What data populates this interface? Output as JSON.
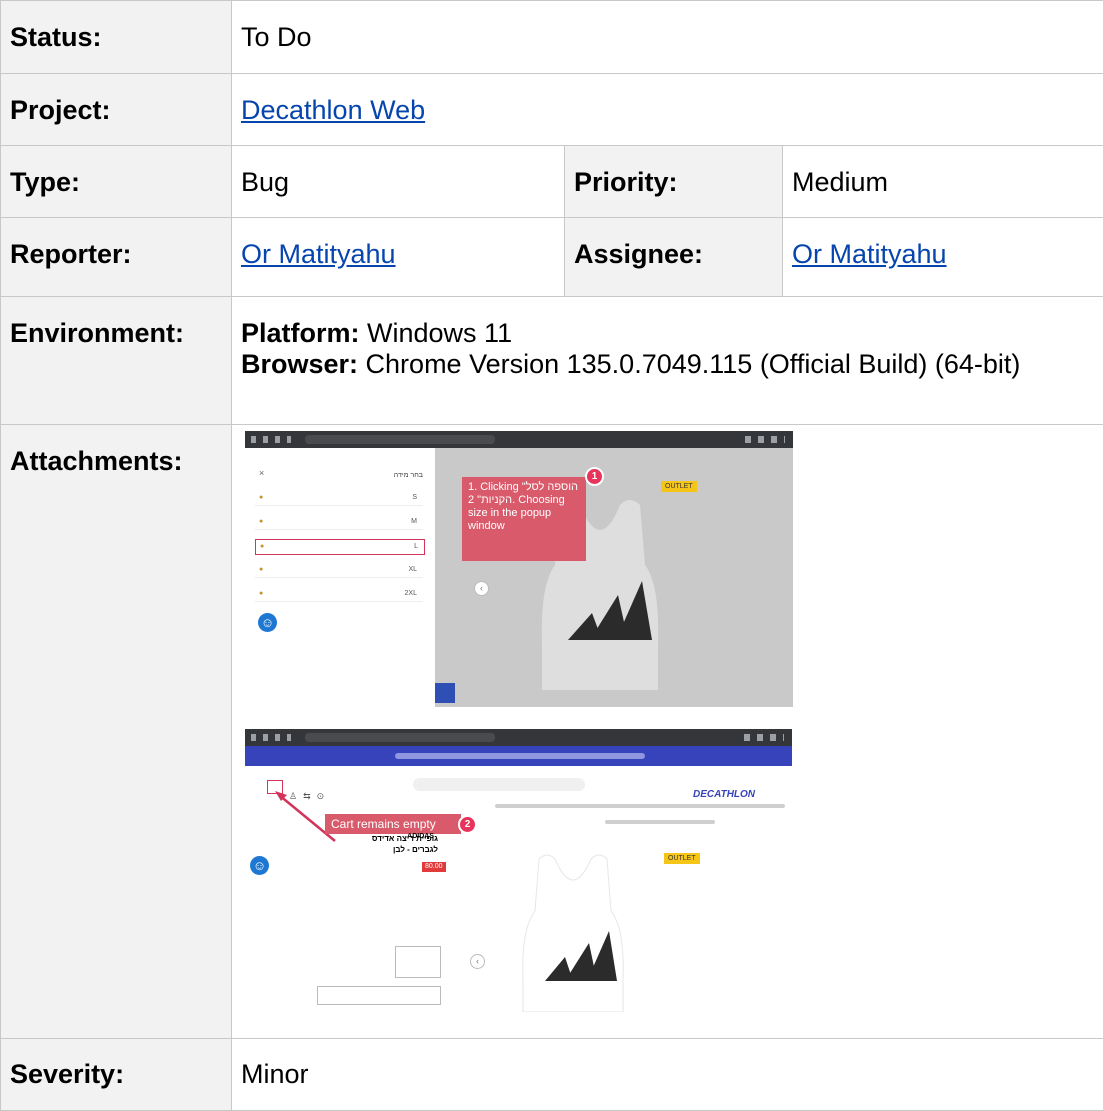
{
  "fields": {
    "status": {
      "label": "Status:",
      "value": "To Do"
    },
    "project": {
      "label": "Project:",
      "value": "Decathlon Web"
    },
    "type": {
      "label": "Type:",
      "value": "Bug"
    },
    "priority": {
      "label": "Priority:",
      "value": "Medium"
    },
    "reporter": {
      "label": "Reporter:",
      "value": "Or Matityahu"
    },
    "assignee": {
      "label": "Assignee:",
      "value": "Or Matityahu"
    },
    "environment": {
      "label": "Environment:",
      "platform_label": "Platform:",
      "platform_value": "Windows 11",
      "browser_label": "Browser:",
      "browser_value": "Chrome Version 135.0.7049.115 (Official Build) (64-bit)"
    },
    "attachments": {
      "label": "Attachments:"
    },
    "severity": {
      "label": "Severity:",
      "value": "Minor"
    }
  },
  "attachments": {
    "shot1": {
      "callout": "1. Clicking \"הוספה לסל הקניות\" 2. Choosing size in the popup window",
      "step": "1",
      "outlet": "OUTLET",
      "popup_title": "בחר מידה",
      "sizes": [
        "S",
        "M",
        "L",
        "XL",
        "2XL"
      ]
    },
    "shot2": {
      "callout": "Cart remains empty",
      "step": "2",
      "logo": "DECATHLON",
      "brand": "ADIDAS",
      "product_title": "גופיית ריצה אדידס לגברים - לבן",
      "price": "80.00",
      "outlet": "OUTLET"
    }
  },
  "colors": {
    "link": "#0645ad",
    "callout": "#d95b6b",
    "badge": "#e8345a",
    "decathlon_blue": "#3643ba"
  }
}
